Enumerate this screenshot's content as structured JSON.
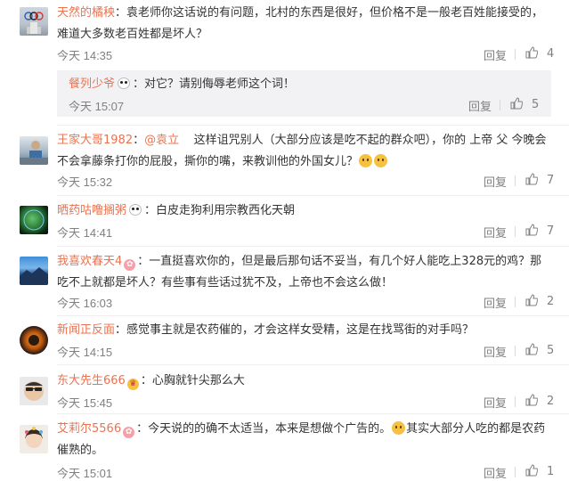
{
  "actions": {
    "reply": "回复"
  },
  "comments": [
    {
      "user": "天然的橘秧",
      "text": "袁老师你这话说的有问题，北村的东西是很好，但价格不是一般老百姓能接受的，难道大多数老百姓都是坏人？",
      "time": "今天 14:35",
      "likes": "4"
    },
    {
      "user": "餐列少爷",
      "text": "对它？请别侮辱老师这个词！",
      "time": "今天 15:07",
      "likes": "5"
    },
    {
      "user": "王家大哥1982",
      "mention": "@袁立",
      "text": "这样诅咒别人（大部分应该是吃不起的群众吧），你的 上帝 父 今晚会不会拿藤条打你的屁股，撕你的嘴，来教训他的外国女儿？",
      "time": "今天 15:32",
      "likes": "7"
    },
    {
      "user": "晒药咕噜搁粥",
      "text": "白皮走狗利用宗教西化天朝",
      "time": "今天 14:41",
      "likes": "7"
    },
    {
      "user": "我喜欢春天4",
      "text": "一直挺喜欢你的，但是最后那句话不妥当，有几个好人能吃上328元的鸡？那吃不上就都是坏人？有些事有些话过犹不及，上帝也不会这么做！",
      "time": "今天 16:03",
      "likes": "2"
    },
    {
      "user": "新闻正反面",
      "text": "感觉事主就是农药催的，才会这样女受精，这是在找骂街的对手吗？",
      "time": "今天 14:15",
      "likes": "5"
    },
    {
      "user": "东大先生666",
      "text": "心胸就针尖那么大",
      "time": "今天 15:45",
      "likes": "2"
    },
    {
      "user": "艾莉尔5566",
      "text": "今天说的的确不太适当，本来是想做个广告的。",
      "text2": "其实大部分人吃的都是农药催熟的。",
      "time": "今天 15:01",
      "likes": "1"
    }
  ],
  "colors": {
    "username": "#eb7350",
    "body_text": "#333333",
    "meta_text": "#808080",
    "sub_reply_bg": "#f2f2f5"
  }
}
